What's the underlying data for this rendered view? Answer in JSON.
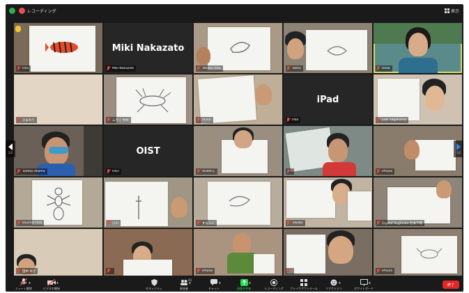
{
  "window": {
    "recording_label": "レコーディング",
    "view_label": "表示",
    "icons": {
      "security": "shield-check-icon",
      "recording": "record-dot-icon",
      "view": "grid-view-icon"
    }
  },
  "participants": [
    {
      "name": "Ishii"
    },
    {
      "name": "Miki Nakazato",
      "big_name": "Miki Nakazato"
    },
    {
      "name": "Tanaka Riko"
    },
    {
      "name": "Takeo"
    },
    {
      "name": "Ueda"
    },
    {
      "name": "ひまわり"
    },
    {
      "name": "ムラリ 中村"
    },
    {
      "name": "miina"
    },
    {
      "name": "iPad",
      "big_name": "iPad"
    },
    {
      "name": "yuki nagahama"
    },
    {
      "name": "Tomiko Akama"
    },
    {
      "name": "OIST",
      "big_name": "OIST"
    },
    {
      "name": "ADVACC"
    },
    {
      "name": ""
    },
    {
      "name": "iPhone"
    },
    {
      "name": "kouchan KID"
    },
    {
      "name": "小川"
    },
    {
      "name": "すなっく"
    },
    {
      "name": "Tokubo"
    },
    {
      "name": "Crystal Sugimoto 杉本千晴"
    },
    {
      "name": "田中 ゆき"
    },
    {
      "name": ""
    },
    {
      "name": "iPhone"
    },
    {
      "name": ""
    },
    {
      "name": "iPhone"
    }
  ],
  "navigation": {
    "prev_page": "1/2",
    "next_page": "1/2"
  },
  "toolbar": {
    "items": [
      {
        "label": "ミュート解除",
        "icon": "mic-muted-icon"
      },
      {
        "label": "ビデオの開始",
        "icon": "video-off-icon"
      },
      {
        "label": "セキュリティ",
        "icon": "shield-icon"
      },
      {
        "label": "参加者",
        "icon": "participants-icon",
        "count": "43"
      },
      {
        "label": "チャット",
        "icon": "chat-icon"
      },
      {
        "label": "画面を共有",
        "icon": "share-screen-icon"
      },
      {
        "label": "レコーディング",
        "icon": "record-icon"
      },
      {
        "label": "ブレイクアウトルーム",
        "icon": "breakout-rooms-icon"
      },
      {
        "label": "リアクション",
        "icon": "reaction-icon"
      },
      {
        "label": "ホワイトボード",
        "icon": "whiteboard-icon"
      }
    ],
    "end_label": "終了"
  },
  "colors": {
    "background": "#1a1a1a",
    "end_button": "#e02828",
    "share_green": "#23d959",
    "muted_red": "#e74c3c",
    "active_speaker": "#d4e06a",
    "nav_accent": "#2d8cff"
  }
}
